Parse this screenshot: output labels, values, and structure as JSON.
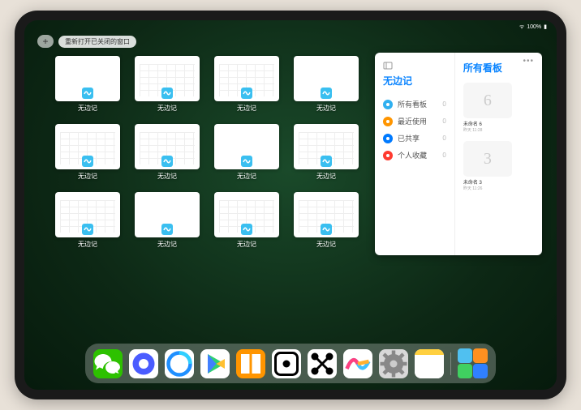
{
  "status": {
    "battery": "100%",
    "signal": "●●●●"
  },
  "topbar": {
    "plus": "+",
    "reopen_label": "重新打开已关闭的窗口"
  },
  "app_label": "无边记",
  "thumbnails": [
    {
      "style": "blank"
    },
    {
      "style": "cal"
    },
    {
      "style": "cal"
    },
    {
      "style": "blank"
    },
    {
      "style": "cal"
    },
    {
      "style": "cal"
    },
    {
      "style": "blank"
    },
    {
      "style": "cal"
    },
    {
      "style": "cal"
    },
    {
      "style": "blank"
    },
    {
      "style": "cal"
    },
    {
      "style": "cal"
    }
  ],
  "panel": {
    "sidebar_title": "无边记",
    "items": [
      {
        "label": "所有看板",
        "count": "0",
        "color": "#30b0f0"
      },
      {
        "label": "最近使用",
        "count": "0",
        "color": "#ff9500"
      },
      {
        "label": "已共享",
        "count": "0",
        "color": "#007aff"
      },
      {
        "label": "个人收藏",
        "count": "0",
        "color": "#ff3b30"
      }
    ],
    "boards_title": "所有看板",
    "boards": [
      {
        "label": "未命名 6",
        "sub": "昨天 11:28",
        "glyph": "6"
      },
      {
        "label": "未命名 3",
        "sub": "昨天 11:26",
        "glyph": "3"
      }
    ]
  },
  "dock": [
    {
      "name": "wechat",
      "bg": "#2dc100",
      "glyph": "wechat"
    },
    {
      "name": "quark",
      "bg": "#ffffff",
      "glyph": "quark"
    },
    {
      "name": "qqbrowser",
      "bg": "#ffffff",
      "glyph": "qqb"
    },
    {
      "name": "aliyun",
      "bg": "#ffffff",
      "glyph": "play"
    },
    {
      "name": "books",
      "bg": "#ff9500",
      "glyph": "book"
    },
    {
      "name": "dice",
      "bg": "#ffffff",
      "glyph": "die"
    },
    {
      "name": "connect",
      "bg": "#ffffff",
      "glyph": "dots"
    },
    {
      "name": "freeform",
      "bg": "#ffffff",
      "glyph": "squiggle"
    },
    {
      "name": "settings",
      "bg": "#d8d8d8",
      "glyph": "gear"
    },
    {
      "name": "notes",
      "bg": "#ffffff",
      "glyph": "notes"
    }
  ]
}
